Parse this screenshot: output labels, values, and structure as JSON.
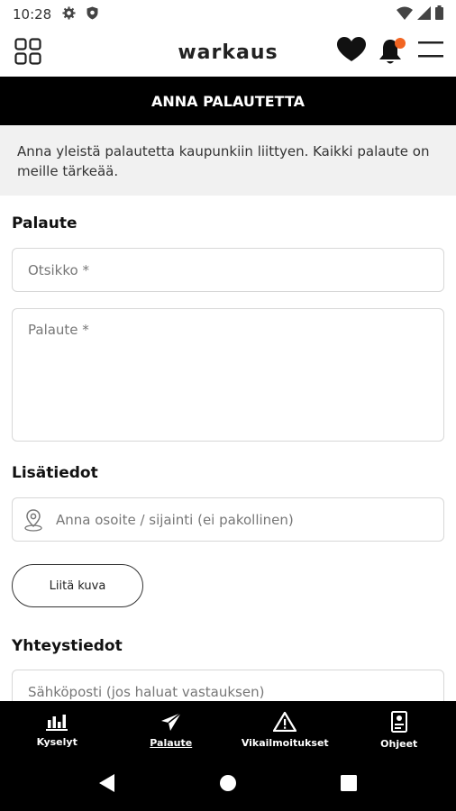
{
  "status_bar": {
    "time": "10:28"
  },
  "header": {
    "brand": "warkaus"
  },
  "title_bar": {
    "title": "ANNA PALAUTETTA"
  },
  "intro": {
    "text": "Anna yleistä palautetta kaupunkiin liittyen. Kaikki palaute on meille tärkeää."
  },
  "feedback_section": {
    "label": "Palaute",
    "title_placeholder": "Otsikko *",
    "body_placeholder": "Palaute *"
  },
  "details_section": {
    "label": "Lisätiedot",
    "location_placeholder": "Anna osoite / sijainti (ei pakollinen)",
    "attach_label": "Liitä kuva"
  },
  "contact_section": {
    "label": "Yhteystiedot",
    "email_placeholder": "Sähköposti (jos haluat vastauksen)"
  },
  "bottom_nav": {
    "items": [
      {
        "label": "Kyselyt",
        "icon": "bar-chart-icon"
      },
      {
        "label": "Palaute",
        "icon": "paper-plane-icon",
        "active": true
      },
      {
        "label": "Vikailmoitukset",
        "icon": "warning-icon"
      },
      {
        "label": "Ohjeet",
        "icon": "guide-icon"
      }
    ]
  },
  "colors": {
    "accent": "#f26522",
    "bar": "#000000",
    "intro_bg": "#f1f1f1"
  }
}
